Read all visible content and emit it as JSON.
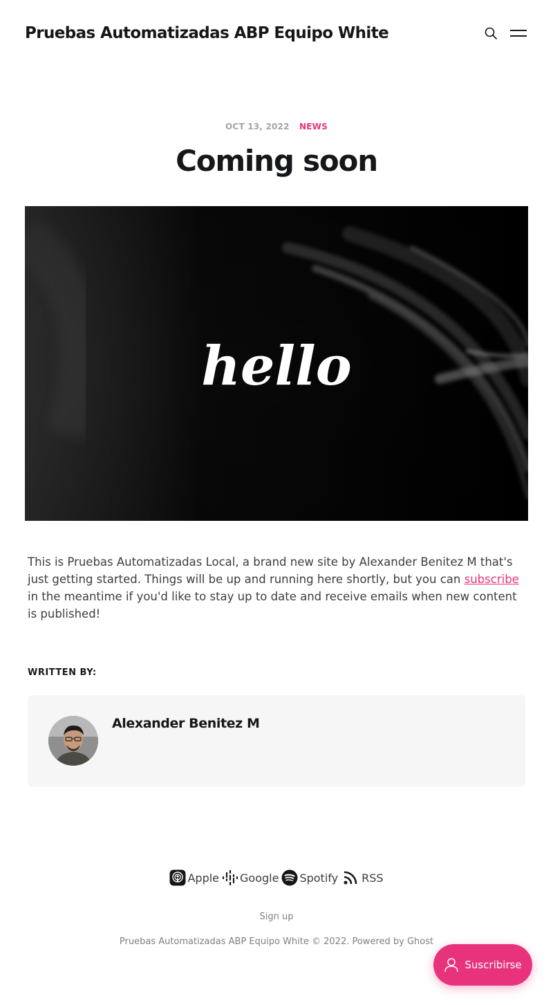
{
  "header": {
    "site_title": "Pruebas Automatizadas ABP Equipo White",
    "search_icon": "search-icon",
    "menu_icon": "hamburger-menu-icon"
  },
  "post": {
    "date": "OCT 13, 2022",
    "tag": "NEWS",
    "title": "Coming soon",
    "feature_image_text": "hello",
    "body_before_link": "This is Pruebas Automatizadas Local, a brand new site by Alexander Benitez M that's just getting started. Things will be up and running here shortly, but you can ",
    "body_link": "subscribe",
    "body_after_link": " in the meantime if you'd like to stay up to date and receive emails when new content is published!"
  },
  "author": {
    "label": "WRITTEN BY:",
    "name": "Alexander Benitez M"
  },
  "footer": {
    "podcast_links": [
      {
        "label": "Apple",
        "icon": "apple-podcasts-icon"
      },
      {
        "label": "Google",
        "icon": "google-podcasts-icon"
      },
      {
        "label": "Spotify",
        "icon": "spotify-icon"
      },
      {
        "label": "RSS",
        "icon": "rss-icon"
      }
    ],
    "signup": "Sign up",
    "copyright": "Pruebas Automatizadas ABP Equipo White © 2022. Powered by Ghost"
  },
  "portal": {
    "subscribe_label": "Suscribirse",
    "icon": "user-icon"
  },
  "colors": {
    "accent": "#e8337c",
    "text": "#15171a",
    "muted": "#7c7f85"
  }
}
